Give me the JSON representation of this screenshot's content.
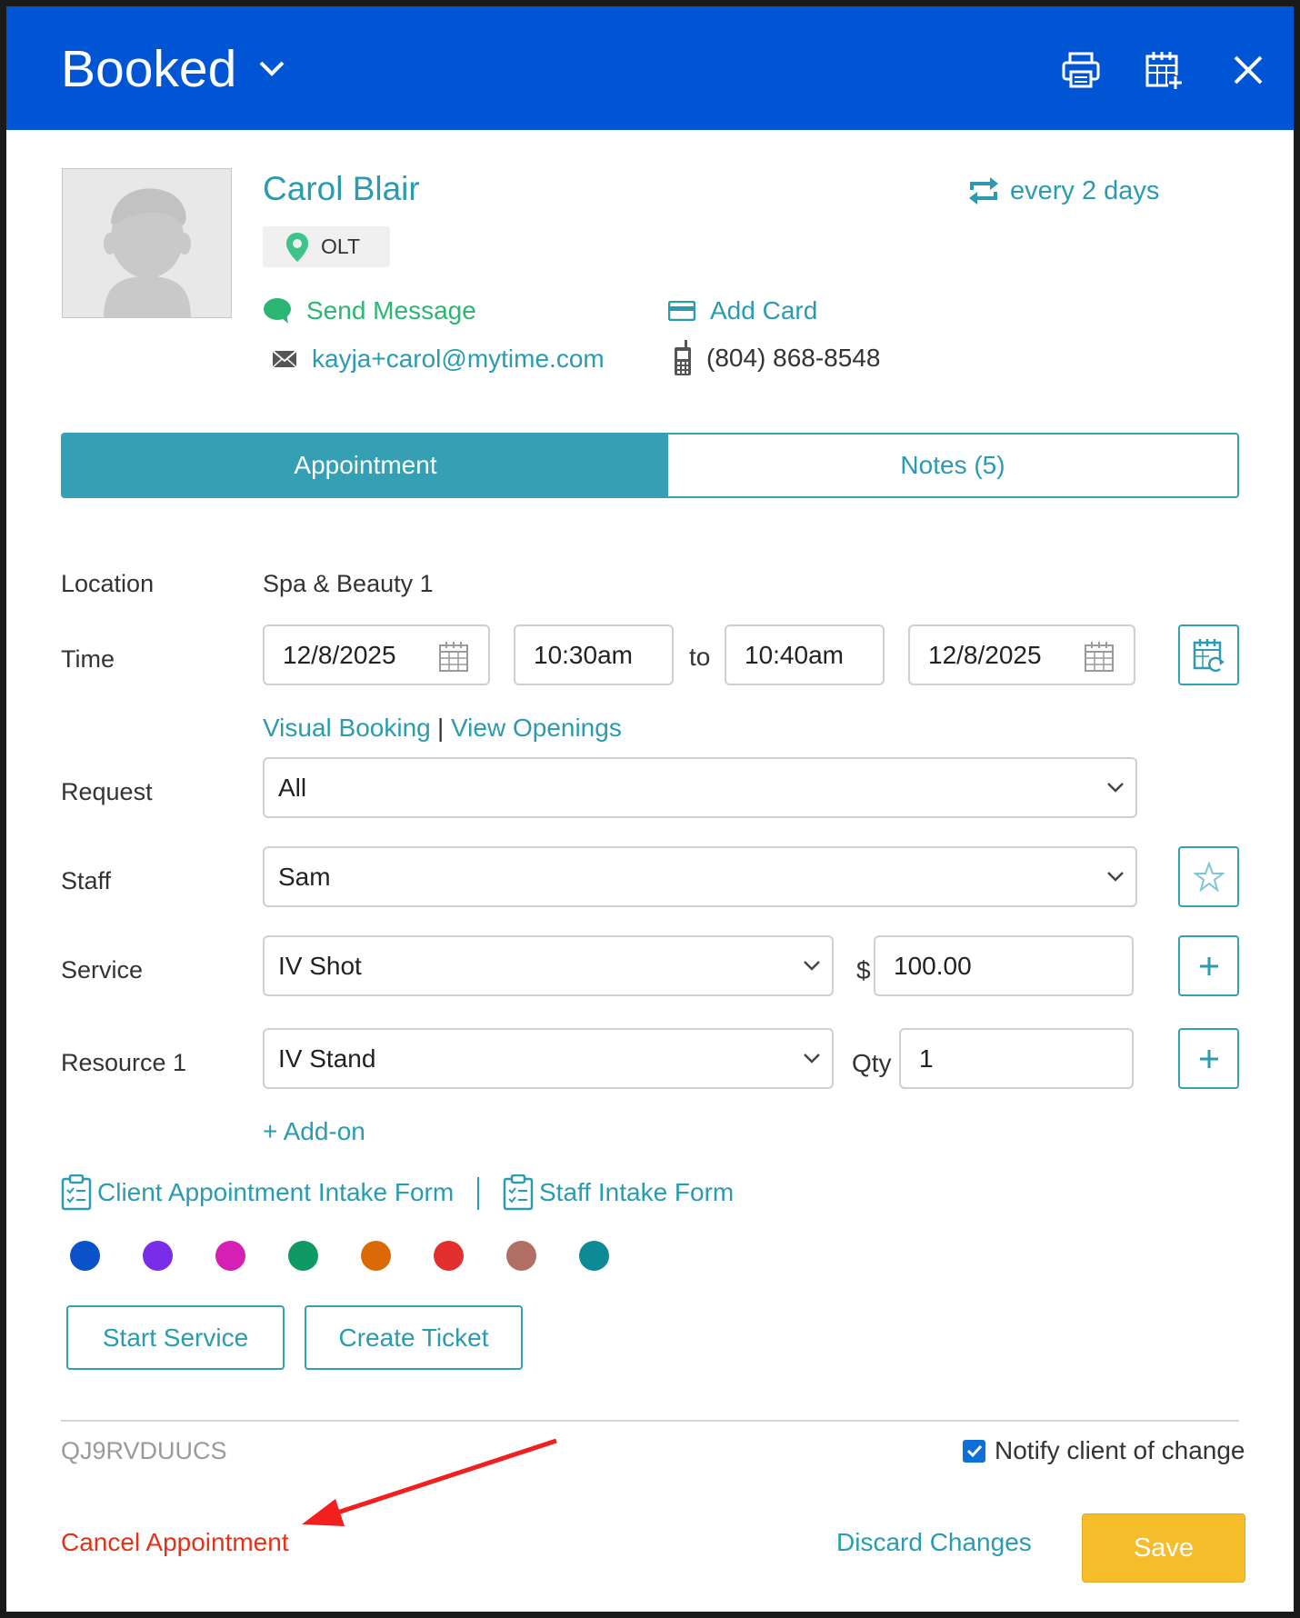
{
  "header": {
    "status": "Booked"
  },
  "client": {
    "name": "Carol Blair",
    "recurrence": "every 2 days",
    "location_badge": "OLT",
    "send_message": "Send Message",
    "add_card": "Add Card",
    "email": "kayja+carol@mytime.com",
    "phone": "(804) 868-8548"
  },
  "tabs": [
    {
      "label": "Appointment"
    },
    {
      "label": "Notes (5)"
    }
  ],
  "form": {
    "location_label": "Location",
    "location_value": "Spa & Beauty 1",
    "time_label": "Time",
    "start_date": "12/8/2025",
    "start_time": "10:30am",
    "to_label": "to",
    "end_time": "10:40am",
    "end_date": "12/8/2025",
    "visual_booking": "Visual Booking",
    "link_sep": "|",
    "view_openings": "View Openings",
    "request_label": "Request",
    "request_value": "All",
    "staff_label": "Staff",
    "staff_value": "Sam",
    "service_label": "Service",
    "service_value": "IV Shot",
    "currency": "$",
    "price": "100.00",
    "resource_label": "Resource 1",
    "resource_value": "IV Stand",
    "qty_label": "Qty",
    "qty_value": "1",
    "add_on": "+ Add-on",
    "client_form": "Client Appointment Intake Form",
    "staff_form": "Staff Intake Form"
  },
  "colors": [
    "#0a52c8",
    "#7a2de6",
    "#d61fb4",
    "#0e9a62",
    "#db6a06",
    "#e2302e",
    "#b06f62",
    "#0d8a95"
  ],
  "actions": {
    "start_service": "Start Service",
    "create_ticket": "Create Ticket"
  },
  "footer": {
    "code": "QJ9RVDUUCS",
    "notify": "Notify client of change",
    "cancel": "Cancel Appointment",
    "discard": "Discard Changes",
    "save": "Save"
  }
}
